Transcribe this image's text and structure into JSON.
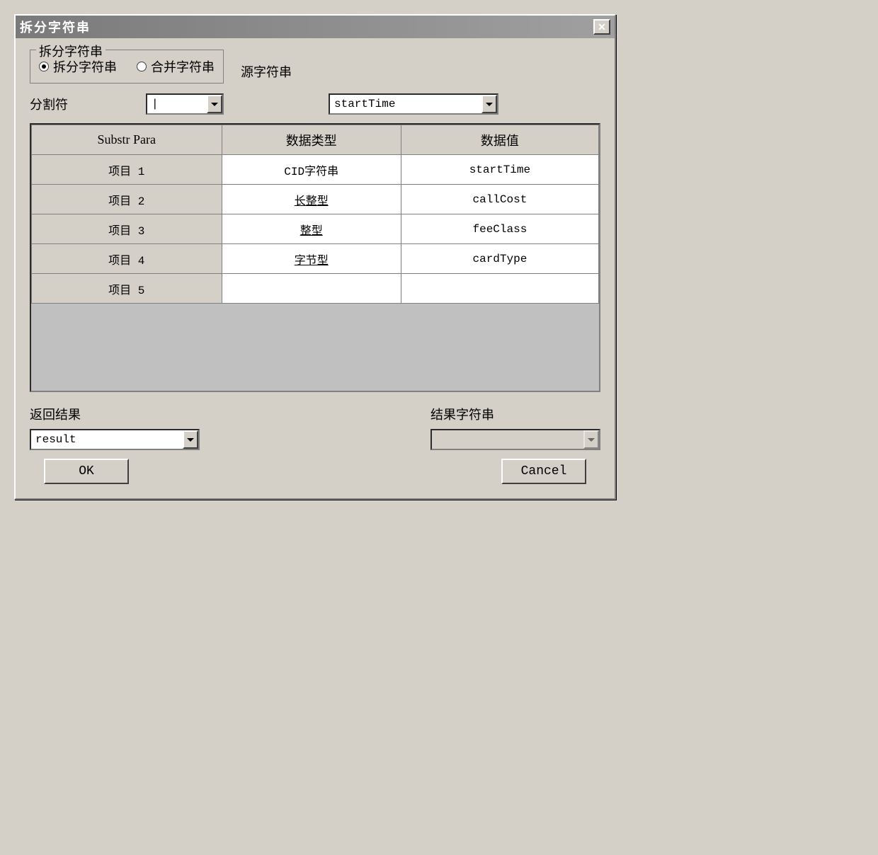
{
  "window": {
    "title": "拆分字符串"
  },
  "mode": {
    "legend": "拆分字符串",
    "split_label": "拆分字符串",
    "merge_label": "合并字符串",
    "selected": "split"
  },
  "source": {
    "label": "源字符串",
    "value": "startTime"
  },
  "delimiter": {
    "label": "分割符",
    "value": "|"
  },
  "table": {
    "headers": [
      "Substr Para",
      "数据类型",
      "数据值"
    ],
    "rows": [
      {
        "item": "项目 1",
        "type": "CID字符串",
        "value": "startTime"
      },
      {
        "item": "项目 2",
        "type": "长整型",
        "value": "callCost"
      },
      {
        "item": "项目 3",
        "type": "整型",
        "value": "feeClass"
      },
      {
        "item": "项目 4",
        "type": "字节型",
        "value": "cardType"
      },
      {
        "item": "项目 5",
        "type": "",
        "value": ""
      }
    ]
  },
  "return_result": {
    "label": "返回结果",
    "value": "result"
  },
  "result_string": {
    "label": "结果字符串",
    "value": ""
  },
  "buttons": {
    "ok": "OK",
    "cancel": "Cancel"
  }
}
